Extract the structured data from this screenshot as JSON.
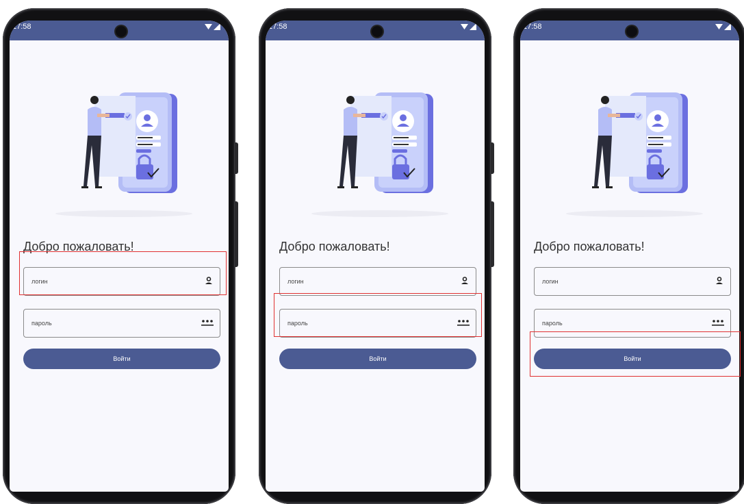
{
  "status": {
    "time": "17:58"
  },
  "screen": {
    "welcome_title": "Добро пожаловать!",
    "login_placeholder": "логин",
    "password_placeholder": "пароль",
    "login_button": "Войти"
  },
  "icons": {
    "login_field_icon": "person-icon",
    "password_field_icon": "password-dots-icon"
  },
  "highlight": {
    "color": "#e03030",
    "targets": [
      "login-field",
      "password-field",
      "login-button"
    ]
  },
  "colors": {
    "accent": "#4b5b93",
    "background": "#f8f8fd",
    "illustration_primary": "#6b6fe0"
  }
}
